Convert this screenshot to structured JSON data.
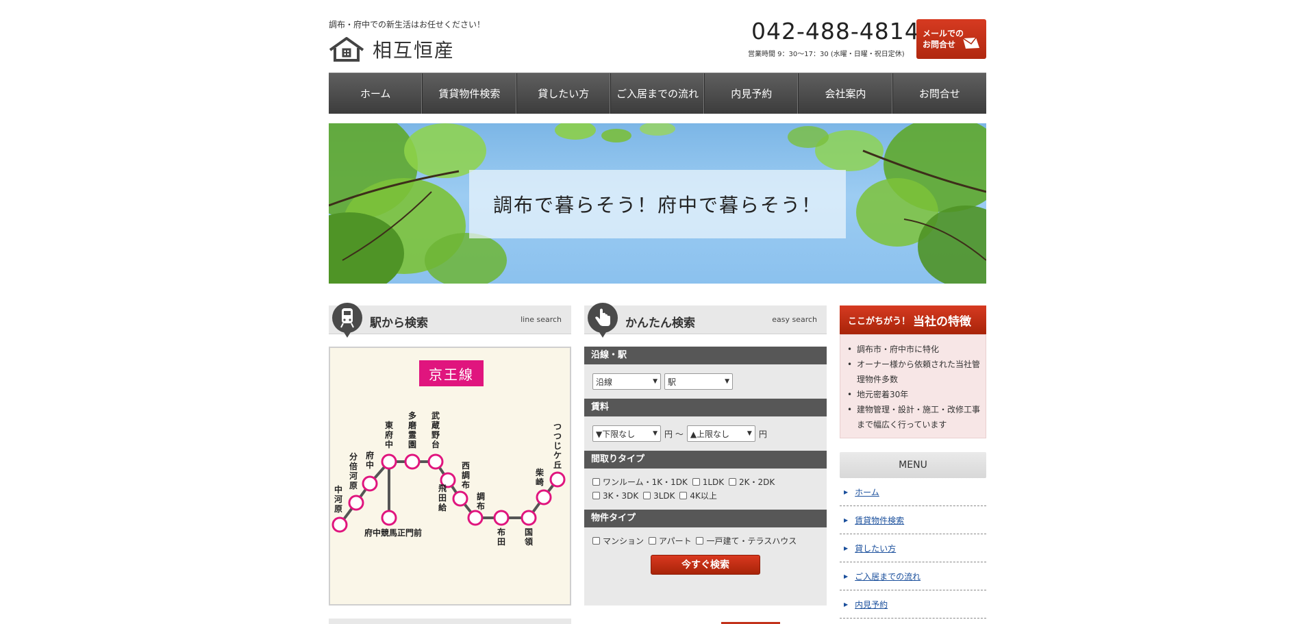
{
  "header": {
    "tagline": "調布・府中での新生活はお任せください！",
    "company_name": "相互恒産",
    "phone": "042-488-4814",
    "hours": "営業時間 9：30〜17：30 (水曜・日曜・祝日定休)",
    "mail_button_line1": "メールでの",
    "mail_button_line2": "お問合せ"
  },
  "nav": {
    "items": [
      "ホーム",
      "賃貸物件検索",
      "貸したい方",
      "ご入居までの流れ",
      "内見予約",
      "会社案内",
      "お問合せ"
    ]
  },
  "hero": {
    "caption": "調布で暮らそう！府中で暮らそう！"
  },
  "line_search": {
    "title": "駅から検索",
    "sub": "line search",
    "line_name": "京王線",
    "stations": [
      "中河原",
      "分倍河原",
      "府中",
      "東府中",
      "府中競馬正門前",
      "多磨霊園",
      "武蔵野台",
      "飛田給",
      "西調布",
      "調布",
      "布田",
      "国領",
      "柴崎",
      "つつじケ丘"
    ]
  },
  "easy_search": {
    "title": "かんたん検索",
    "sub": "easy search",
    "route_label": "沿線・駅",
    "line_select": "沿線",
    "station_select": "駅",
    "rent_label": "賃料",
    "rent_min": "▼下限なし",
    "rent_unit1": "円 〜",
    "rent_max": "▲上限なし",
    "rent_unit2": "円",
    "layout_label": "間取りタイプ",
    "layouts": [
      "ワンルーム・1K・1DK",
      "1LDK",
      "2K・2DK",
      "3K・3DK",
      "3LDK",
      "4K以上"
    ],
    "type_label": "物件タイプ",
    "types": [
      "マンション",
      "アパート",
      "一戸建て・テラスハウス"
    ],
    "search_button": "今すぐ検索"
  },
  "features": {
    "head_small": "ここがちがう！",
    "head_big": "当社の特徴",
    "items": [
      "調布市・府中市に特化",
      "オーナー様から依頼された当社管理物件多数",
      "地元密着30年",
      "建物管理・設計・施工・改修工事まで幅広く行っています"
    ]
  },
  "menu": {
    "title": "MENU",
    "items": [
      "ホーム",
      "賃貸物件検索",
      "貸したい方",
      "ご入居までの流れ",
      "内見予約"
    ]
  },
  "colors": {
    "accent_red": "#c2321b",
    "line_pink": "#e0157e",
    "nav_dark": "#4a4a4a"
  }
}
